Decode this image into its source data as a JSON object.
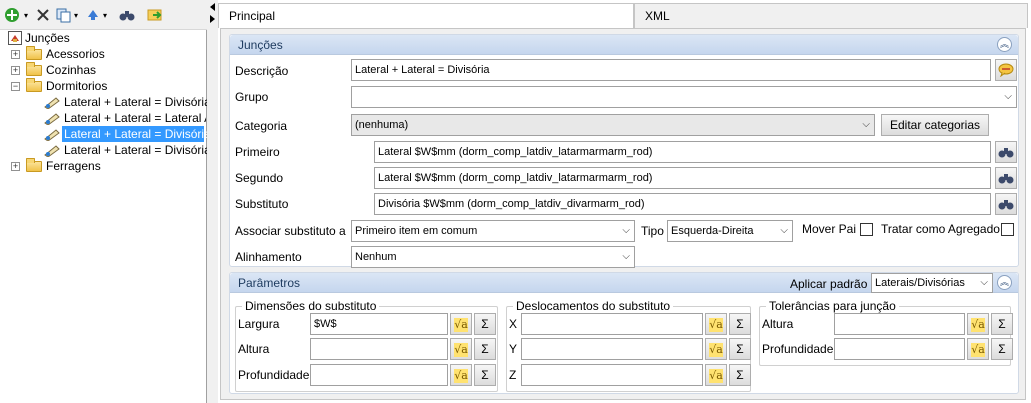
{
  "tree": {
    "root": "Junções",
    "items": [
      {
        "label": "Acessorios"
      },
      {
        "label": "Cozinhas"
      },
      {
        "label": "Dormitorios"
      },
      {
        "label": "Lateral + Lateral = Divisória"
      },
      {
        "label": "Lateral + Lateral = Lateral A"
      },
      {
        "label": "Lateral + Lateral = Divisória"
      },
      {
        "label": "Lateral + Lateral = Divisória"
      },
      {
        "label": "Ferragens"
      }
    ]
  },
  "tabs": {
    "principal": "Principal",
    "xml": "XML"
  },
  "juncoes": {
    "title": "Junções",
    "descricao_label": "Descrição",
    "descricao_value": "Lateral + Lateral = Divisória",
    "grupo_label": "Grupo",
    "grupo_value": "",
    "categoria_label": "Categoria",
    "categoria_value": "(nenhuma)",
    "editar_button": "Editar categorias",
    "primeiro_label": "Primeiro",
    "primeiro_value": "Lateral $W$mm (dorm_comp_latdiv_latarmarmarm_rod)",
    "segundo_label": "Segundo",
    "segundo_value": "Lateral $W$mm (dorm_comp_latdiv_latarmarmarm_rod)",
    "substituto_label": "Substituto",
    "substituto_value": "Divisória $W$mm (dorm_comp_latdiv_divarmarm_rod)",
    "associar_label": "Associar substituto a",
    "associar_value": "Primeiro item em comum",
    "tipo_label": "Tipo",
    "tipo_value": "Esquerda-Direita",
    "mover_pai_label": "Mover Pai",
    "tratar_label": "Tratar como Agregado",
    "alinhamento_label": "Alinhamento",
    "alinhamento_value": "Nenhum"
  },
  "parametros": {
    "title": "Parâmetros",
    "aplicar_label": "Aplicar padrão",
    "aplicar_value": "Laterais/Divisórias",
    "dimensoes": {
      "title": "Dimensões do substituto",
      "largura_label": "Largura",
      "largura_value": "$W$",
      "altura_label": "Altura",
      "altura_value": "",
      "profundidade_label": "Profundidade",
      "profundidade_value": ""
    },
    "deslocamentos": {
      "title": "Deslocamentos do substituto",
      "x_label": "X",
      "y_label": "Y",
      "z_label": "Z"
    },
    "tolerancias": {
      "title": "Tolerâncias para junção",
      "altura_label": "Altura",
      "profundidade_label": "Profundidade"
    }
  },
  "icons": {
    "fx_glyph": "√a",
    "sigma_glyph": "Σ",
    "binoculars_glyph": "⛭"
  }
}
